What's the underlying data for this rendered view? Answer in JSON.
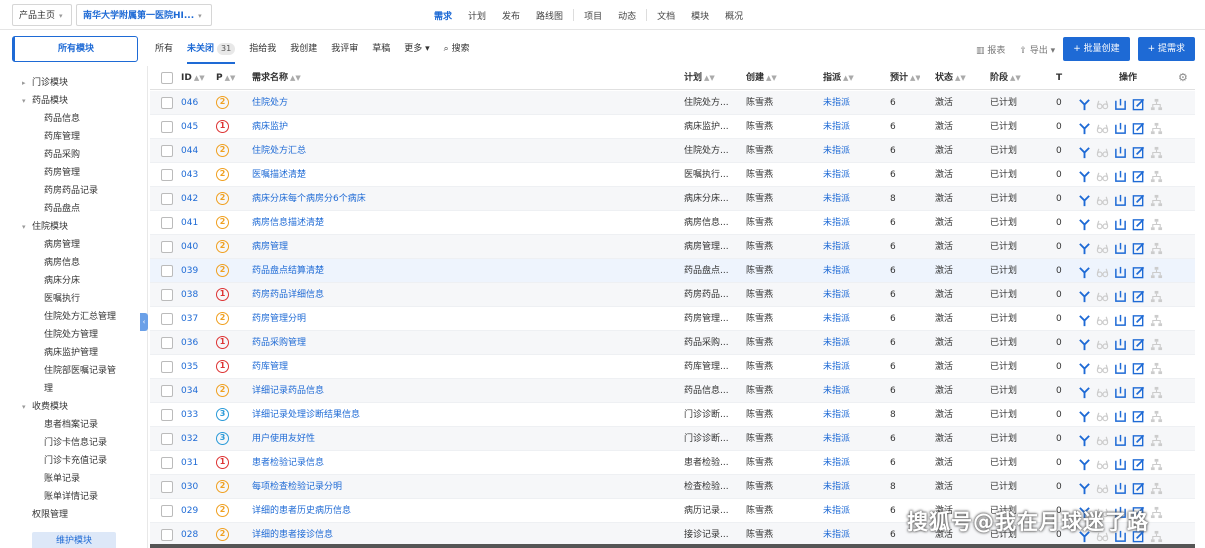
{
  "topbar": {
    "product_home": "产品主页",
    "product_name": "南华大学附属第一医院HI...",
    "nav": [
      "需求",
      "计划",
      "发布",
      "路线图",
      "项目",
      "动态",
      "文档",
      "模块",
      "概况"
    ],
    "active_nav": "需求"
  },
  "secbar": {
    "all_modules": "所有模块",
    "tabs": [
      {
        "label": "所有"
      },
      {
        "label": "未关闭",
        "count": "31"
      },
      {
        "label": "指给我"
      },
      {
        "label": "我创建"
      },
      {
        "label": "我评审"
      },
      {
        "label": "草稿"
      },
      {
        "label": "更多 ▾"
      },
      {
        "label": "搜索"
      }
    ],
    "report": "报表",
    "export": "导出",
    "batch_create": "+ 批量创建",
    "create": "+ 提需求"
  },
  "sidebar": {
    "items": [
      {
        "label": "门诊模块",
        "level": 0,
        "arrow": "▸"
      },
      {
        "label": "药品模块",
        "level": 0,
        "arrow": "▾"
      },
      {
        "label": "药品信息",
        "level": 1
      },
      {
        "label": "药库管理",
        "level": 1
      },
      {
        "label": "药品采购",
        "level": 1
      },
      {
        "label": "药房管理",
        "level": 1
      },
      {
        "label": "药房药品记录",
        "level": 1
      },
      {
        "label": "药品盘点",
        "level": 1
      },
      {
        "label": "住院模块",
        "level": 0,
        "arrow": "▾"
      },
      {
        "label": "病房管理",
        "level": 1
      },
      {
        "label": "病房信息",
        "level": 1
      },
      {
        "label": "病床分床",
        "level": 1
      },
      {
        "label": "医嘱执行",
        "level": 1
      },
      {
        "label": "住院处方汇总管理",
        "level": 1
      },
      {
        "label": "住院处方管理",
        "level": 1
      },
      {
        "label": "病床监护管理",
        "level": 1
      },
      {
        "label": "住院部医嘱记录管",
        "level": 1
      },
      {
        "label": "理",
        "level": 1
      },
      {
        "label": "收费模块",
        "level": 0,
        "arrow": "▾"
      },
      {
        "label": "患者档案记录",
        "level": 1
      },
      {
        "label": "门诊卡信息记录",
        "level": 1
      },
      {
        "label": "门诊卡充值记录",
        "level": 1
      },
      {
        "label": "账单记录",
        "level": 1
      },
      {
        "label": "账单详情记录",
        "level": 1
      },
      {
        "label": "权限管理",
        "level": 0,
        "arrow": ""
      }
    ],
    "maintain": "维护模块"
  },
  "table": {
    "headers": {
      "id": "ID",
      "p": "P",
      "name": "需求名称",
      "plan": "计划",
      "creator": "创建",
      "assign": "指派",
      "est": "预计",
      "status": "状态",
      "stage": "阶段",
      "t": "T",
      "actions": "操作"
    },
    "rows": [
      {
        "id": "046",
        "p": "2",
        "name": "住院处方",
        "plan": "住院处方...",
        "creator": "陈雪燕",
        "assign": "未指派",
        "est": "6",
        "status": "激活",
        "stage": "已计划",
        "t": "0"
      },
      {
        "id": "045",
        "p": "1",
        "name": "病床监护",
        "plan": "病床监护...",
        "creator": "陈雪燕",
        "assign": "未指派",
        "est": "6",
        "status": "激活",
        "stage": "已计划",
        "t": "0"
      },
      {
        "id": "044",
        "p": "2",
        "name": "住院处方汇总",
        "plan": "住院处方...",
        "creator": "陈雪燕",
        "assign": "未指派",
        "est": "6",
        "status": "激活",
        "stage": "已计划",
        "t": "0"
      },
      {
        "id": "043",
        "p": "2",
        "name": "医嘱描述清楚",
        "plan": "医嘱执行...",
        "creator": "陈雪燕",
        "assign": "未指派",
        "est": "6",
        "status": "激活",
        "stage": "已计划",
        "t": "0"
      },
      {
        "id": "042",
        "p": "2",
        "name": "病床分床每个病房分6个病床",
        "plan": "病床分床...",
        "creator": "陈雪燕",
        "assign": "未指派",
        "est": "8",
        "status": "激活",
        "stage": "已计划",
        "t": "0"
      },
      {
        "id": "041",
        "p": "2",
        "name": "病房信息描述清楚",
        "plan": "病房信息...",
        "creator": "陈雪燕",
        "assign": "未指派",
        "est": "6",
        "status": "激活",
        "stage": "已计划",
        "t": "0"
      },
      {
        "id": "040",
        "p": "2",
        "name": "病房管理",
        "plan": "病房管理...",
        "creator": "陈雪燕",
        "assign": "未指派",
        "est": "6",
        "status": "激活",
        "stage": "已计划",
        "t": "0"
      },
      {
        "id": "039",
        "p": "2",
        "name": "药品盘点结算清楚",
        "plan": "药品盘点...",
        "creator": "陈雪燕",
        "assign": "未指派",
        "est": "6",
        "status": "激活",
        "stage": "已计划",
        "t": "0"
      },
      {
        "id": "038",
        "p": "1",
        "name": "药房药品详细信息",
        "plan": "药房药品...",
        "creator": "陈雪燕",
        "assign": "未指派",
        "est": "6",
        "status": "激活",
        "stage": "已计划",
        "t": "0"
      },
      {
        "id": "037",
        "p": "2",
        "name": "药房管理分明",
        "plan": "药房管理...",
        "creator": "陈雪燕",
        "assign": "未指派",
        "est": "6",
        "status": "激活",
        "stage": "已计划",
        "t": "0"
      },
      {
        "id": "036",
        "p": "1",
        "name": "药品采购管理",
        "plan": "药品采购...",
        "creator": "陈雪燕",
        "assign": "未指派",
        "est": "6",
        "status": "激活",
        "stage": "已计划",
        "t": "0"
      },
      {
        "id": "035",
        "p": "1",
        "name": "药库管理",
        "plan": "药库管理...",
        "creator": "陈雪燕",
        "assign": "未指派",
        "est": "6",
        "status": "激活",
        "stage": "已计划",
        "t": "0"
      },
      {
        "id": "034",
        "p": "2",
        "name": "详细记录药品信息",
        "plan": "药品信息...",
        "creator": "陈雪燕",
        "assign": "未指派",
        "est": "6",
        "status": "激活",
        "stage": "已计划",
        "t": "0"
      },
      {
        "id": "033",
        "p": "3",
        "name": "详细记录处理诊断结果信息",
        "plan": "门诊诊断...",
        "creator": "陈雪燕",
        "assign": "未指派",
        "est": "8",
        "status": "激活",
        "stage": "已计划",
        "t": "0"
      },
      {
        "id": "032",
        "p": "3",
        "name": "用户使用友好性",
        "plan": "门诊诊断...",
        "creator": "陈雪燕",
        "assign": "未指派",
        "est": "6",
        "status": "激活",
        "stage": "已计划",
        "t": "0"
      },
      {
        "id": "031",
        "p": "1",
        "name": "患者检验记录信息",
        "plan": "患者检验...",
        "creator": "陈雪燕",
        "assign": "未指派",
        "est": "6",
        "status": "激活",
        "stage": "已计划",
        "t": "0"
      },
      {
        "id": "030",
        "p": "2",
        "name": "每项检查检验记录分明",
        "plan": "检查检验...",
        "creator": "陈雪燕",
        "assign": "未指派",
        "est": "8",
        "status": "激活",
        "stage": "已计划",
        "t": "0"
      },
      {
        "id": "029",
        "p": "2",
        "name": "详细的患者历史病历信息",
        "plan": "病历记录...",
        "creator": "陈雪燕",
        "assign": "未指派",
        "est": "6",
        "status": "激活",
        "stage": "已计划",
        "t": "0"
      },
      {
        "id": "028",
        "p": "2",
        "name": "详细的患者接诊信息",
        "plan": "接诊记录...",
        "creator": "陈雪燕",
        "assign": "未指派",
        "est": "6",
        "status": "激活",
        "stage": "已计划",
        "t": "0"
      }
    ]
  },
  "watermark": "搜狐号@我在月球迷了路",
  "colors": {
    "accent": "#1e6ad5",
    "p1": "#dd3333",
    "p2": "#f0a020",
    "p3": "#2a9ad8"
  }
}
